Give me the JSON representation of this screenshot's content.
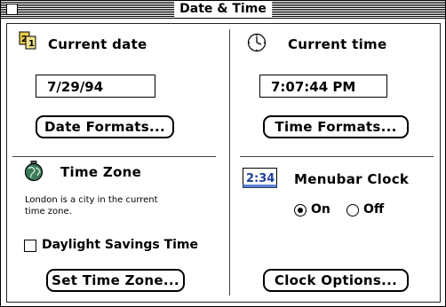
{
  "window": {
    "title": "Date & Time"
  },
  "date": {
    "heading": "Current date",
    "value": "7/29/94",
    "formats_button": "Date Formats..."
  },
  "time": {
    "heading": "Current time",
    "value": "7:07:44 PM",
    "formats_button": "Time Formats..."
  },
  "timezone": {
    "heading": "Time Zone",
    "description": "London is a city in the current time zone.",
    "dst_label": "Daylight Savings Time",
    "dst_checked": false,
    "set_button": "Set Time Zone..."
  },
  "menubar_clock": {
    "heading": "Menubar Clock",
    "icon_text": "2:34",
    "on_label": "On",
    "off_label": "Off",
    "selected": "On",
    "options_button": "Clock Options..."
  },
  "icons": {
    "date": "calendar-icon",
    "time": "clock-icon",
    "timezone": "globe-icon",
    "menubar": "digital-clock-icon"
  }
}
